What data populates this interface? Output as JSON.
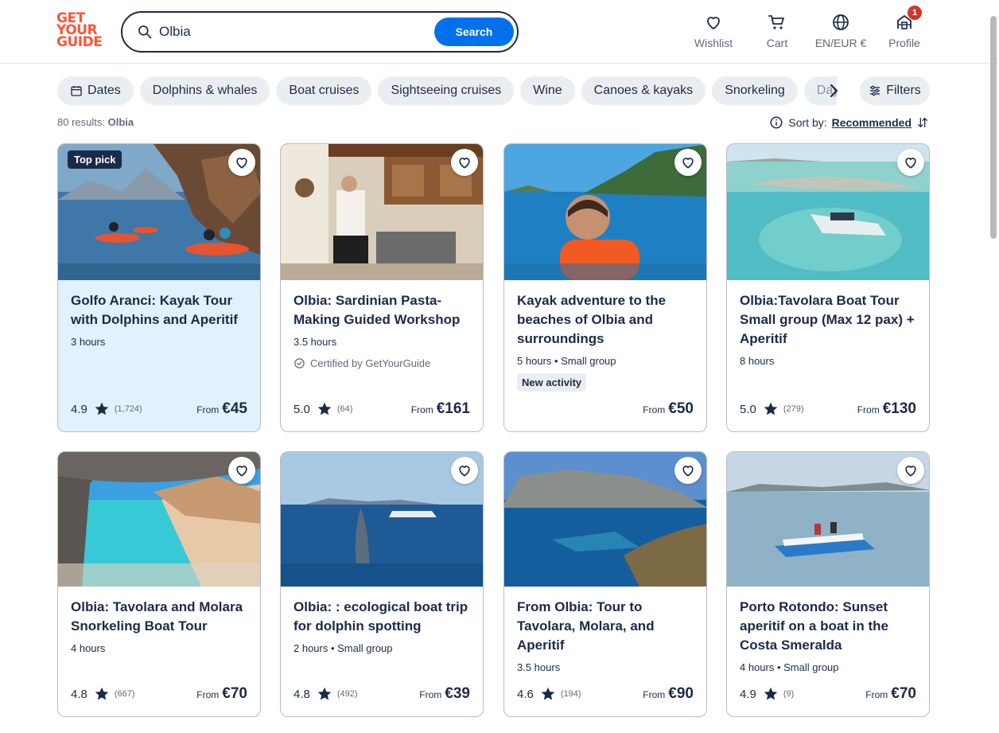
{
  "logo": {
    "line1": "GET",
    "line2": "YOUR",
    "line3": "GUIDE",
    "color": "#ff5533"
  },
  "search": {
    "value": "Olbia",
    "button": "Search"
  },
  "nav": [
    {
      "label": "Wishlist",
      "icon": "heart-icon"
    },
    {
      "label": "Cart",
      "icon": "cart-icon"
    },
    {
      "label": "EN/EUR €",
      "icon": "globe-icon"
    },
    {
      "label": "Profile",
      "icon": "profile-icon",
      "badge": "1"
    }
  ],
  "chips": [
    "Dates",
    "Dolphins & whales",
    "Boat cruises",
    "Sightseeing cruises",
    "Wine",
    "Canoes & kayaks",
    "Snorkeling",
    "Day t"
  ],
  "filters_label": "Filters",
  "results": {
    "prefix": "80 results:",
    "query": "Olbia"
  },
  "sort": {
    "label": "Sort by:",
    "value": "Recommended"
  },
  "cards": [
    {
      "title": "Golfo Aranci: Kayak Tour with Dolphins and Aperitif",
      "duration": "3 hours",
      "rating": "4.9",
      "count": "(1,724)",
      "from": "From",
      "price": "€45",
      "badge": "Top pick"
    },
    {
      "title": "Olbia: Sardinian Pasta-Making Guided Workshop",
      "duration": "3.5 hours",
      "cert": "Certified by GetYourGuide",
      "rating": "5.0",
      "count": "(64)",
      "from": "From",
      "price": "€161"
    },
    {
      "title": "Kayak adventure to the beaches of Olbia and surroundings",
      "duration": "5 hours • Small group",
      "tag": "New activity",
      "from": "From",
      "price": "€50"
    },
    {
      "title": "Olbia:Tavolara Boat Tour Small group (Max 12 pax) + Aperitif",
      "duration": "8 hours",
      "rating": "5.0",
      "count": "(279)",
      "from": "From",
      "price": "€130"
    },
    {
      "title": "Olbia: Tavolara and Molara Snorkeling Boat Tour",
      "duration": "4 hours",
      "rating": "4.8",
      "count": "(667)",
      "from": "From",
      "price": "€70"
    },
    {
      "title": "Olbia: : ecological boat trip for dolphin spotting",
      "duration": "2 hours • Small group",
      "rating": "4.8",
      "count": "(492)",
      "from": "From",
      "price": "€39"
    },
    {
      "title": "From Olbia: Tour to Tavolara, Molara, and Aperitif",
      "duration": "3.5 hours",
      "rating": "4.6",
      "count": "(194)",
      "from": "From",
      "price": "€90"
    },
    {
      "title": "Porto Rotondo: Sunset aperitif on a boat in the Costa Smeralda",
      "duration": "4 hours • Small group",
      "rating": "4.9",
      "count": "(9)",
      "from": "From",
      "price": "€70"
    }
  ],
  "colors": {
    "accent": "#0071eb",
    "text": "#1a2b49",
    "highlight": "#e2f1fe",
    "badge": "#d0362b"
  }
}
